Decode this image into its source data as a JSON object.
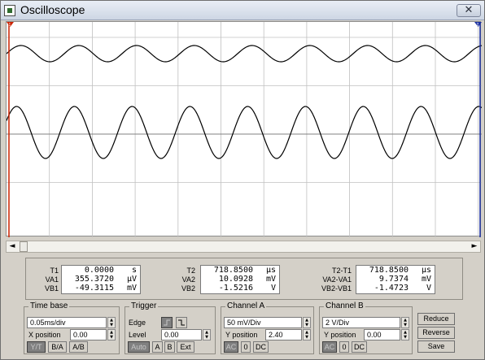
{
  "window": {
    "title": "Oscilloscope",
    "close": "✕"
  },
  "cursors": {
    "t1_marker": "1",
    "t2_marker": "2"
  },
  "scrollbar": {
    "left": "◄",
    "right": "►"
  },
  "readout": {
    "col1": {
      "labels": [
        "T1",
        "VA1",
        "VB1"
      ],
      "values": [
        "0.0000",
        "355.3720",
        "-49.3115"
      ],
      "units": [
        "s",
        "μV",
        "mV"
      ]
    },
    "col2": {
      "labels": [
        "T2",
        "VA2",
        "VB2"
      ],
      "values": [
        "718.8500",
        "10.0928",
        "-1.5216"
      ],
      "units": [
        "μs",
        "mV",
        "V"
      ]
    },
    "col3": {
      "labels": [
        "T2-T1",
        "VA2-VA1",
        "VB2-VB1"
      ],
      "values": [
        "718.8500",
        "9.7374",
        "-1.4723"
      ],
      "units": [
        "μs",
        "mV",
        "V"
      ]
    }
  },
  "timebase": {
    "title": "Time base",
    "scale": "0.05ms/div",
    "xpos_label": "X position",
    "xpos": "0.00",
    "modes": [
      "Y/T",
      "B/A",
      "A/B"
    ]
  },
  "trigger": {
    "title": "Trigger",
    "edge_label": "Edge",
    "level_label": "Level",
    "level": "0.00",
    "rise_icon": "rising-edge-icon",
    "fall_icon": "falling-edge-icon",
    "sources": [
      "Auto",
      "A",
      "B",
      "Ext"
    ]
  },
  "channel_a": {
    "title": "Channel A",
    "scale": "50 mV/Div",
    "ypos_label": "Y position",
    "ypos": "2.40",
    "coupling": [
      "AC",
      "0",
      "DC"
    ]
  },
  "channel_b": {
    "title": "Channel B",
    "scale": "2 V/Div",
    "ypos_label": "Y position",
    "ypos": "0.00",
    "coupling": [
      "AC",
      "0",
      "DC"
    ]
  },
  "actions": {
    "reduce": "Reduce",
    "reverse": "Reverse",
    "save": "Save"
  },
  "colors": {
    "trace": "#000000",
    "grid": "#c0c0c0",
    "cursor1": "#cc2200",
    "cursor2": "#1a2fa0"
  }
}
